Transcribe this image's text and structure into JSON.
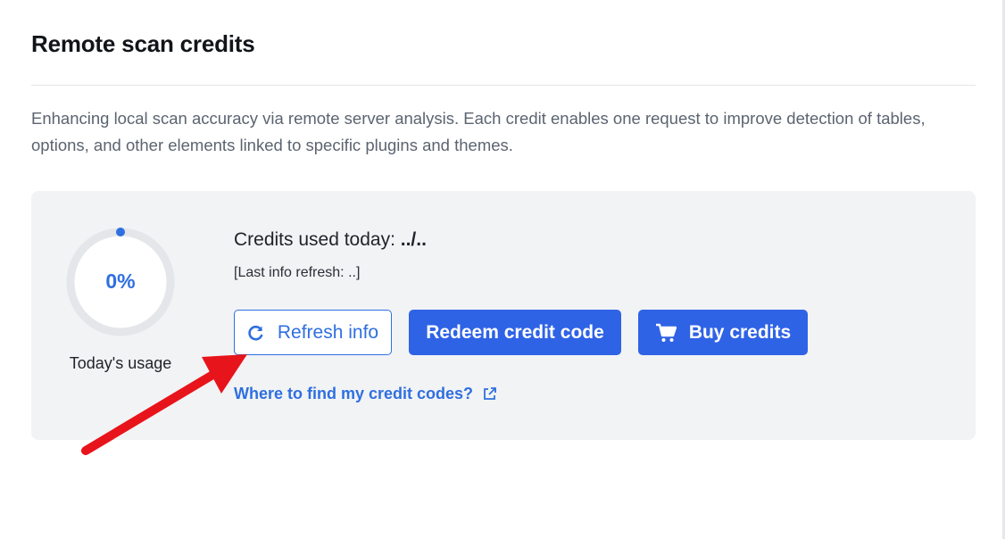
{
  "header": {
    "title": "Remote scan credits"
  },
  "description": "Enhancing local scan accuracy via remote server analysis. Each credit enables one request to improve detection of tables, options, and other elements linked to specific plugins and themes.",
  "usage": {
    "percent_label": "0%",
    "percent_value": 0,
    "caption": "Today's usage",
    "credits_label": "Credits used today: ",
    "credits_value": "../..",
    "last_refresh": "[Last info refresh: ..]"
  },
  "actions": {
    "refresh_label": "Refresh info",
    "redeem_label": "Redeem credit code",
    "buy_label": "Buy credits"
  },
  "help_link": "Where to find my credit codes?",
  "icons": {
    "refresh": "refresh-icon",
    "cart": "cart-icon",
    "external_link": "external-link-icon"
  },
  "colors": {
    "accent": "#2f63e6",
    "annotation": "#e8141b",
    "panel": "#f2f3f5"
  }
}
